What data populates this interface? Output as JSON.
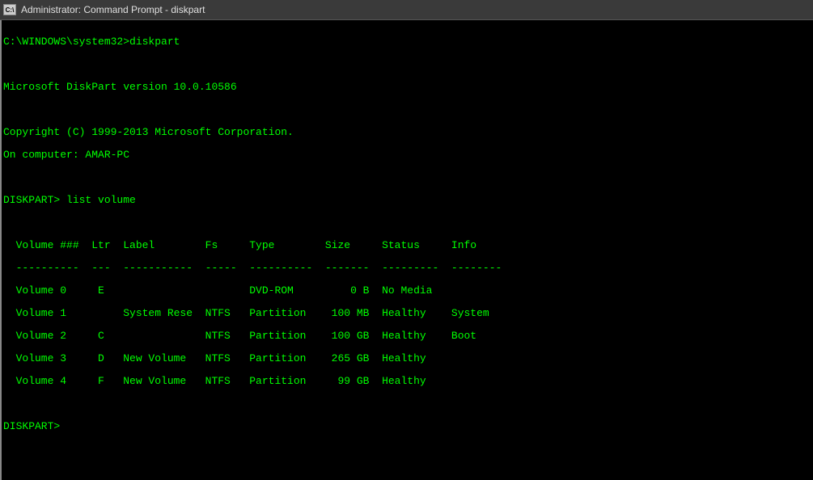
{
  "titlebar": {
    "icon_label": "C:\\",
    "title": "Administrator: Command Prompt - diskpart"
  },
  "terminal": {
    "prompt1": "C:\\WINDOWS\\system32>diskpart",
    "blank": "",
    "version": "Microsoft DiskPart version 10.0.10586",
    "copyright": "Copyright (C) 1999-2013 Microsoft Corporation.",
    "computer": "On computer: AMAR-PC",
    "prompt2": "DISKPART> list volume",
    "headers": "  Volume ###  Ltr  Label        Fs     Type        Size     Status     Info",
    "separator": "  ----------  ---  -----------  -----  ----------  -------  ---------  --------",
    "volumes": [
      "  Volume 0     E                       DVD-ROM         0 B  No Media",
      "  Volume 1         System Rese  NTFS   Partition    100 MB  Healthy    System",
      "  Volume 2     C                NTFS   Partition    100 GB  Healthy    Boot",
      "  Volume 3     D   New Volume   NTFS   Partition    265 GB  Healthy",
      "  Volume 4     F   New Volume   NTFS   Partition     99 GB  Healthy"
    ],
    "prompt3": "DISKPART>"
  }
}
